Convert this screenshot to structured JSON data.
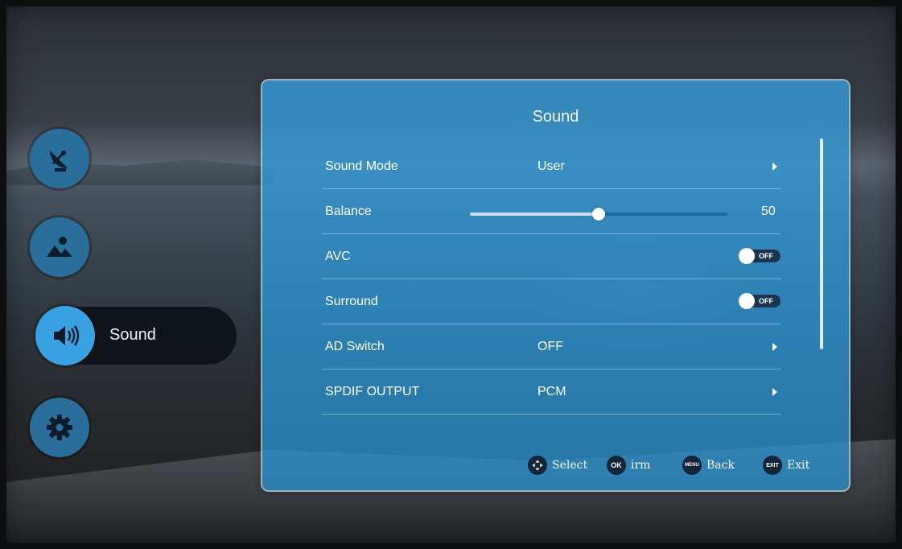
{
  "side_menu": {
    "items": [
      {
        "icon": "satellite-dish-icon",
        "label": ""
      },
      {
        "icon": "picture-icon",
        "label": ""
      },
      {
        "icon": "speaker-icon",
        "label": "Sound"
      },
      {
        "icon": "gear-icon",
        "label": ""
      }
    ],
    "selected": "Sound"
  },
  "panel": {
    "title": "Sound",
    "rows": [
      {
        "label": "Sound Mode",
        "value": "User",
        "type": "submenu"
      },
      {
        "label": "Balance",
        "value": "50",
        "type": "slider",
        "fraction": 0.5
      },
      {
        "label": "AVC",
        "value": "OFF",
        "type": "toggle"
      },
      {
        "label": "Surround",
        "value": "OFF",
        "type": "toggle"
      },
      {
        "label": "AD Switch",
        "value": "OFF",
        "type": "submenu"
      },
      {
        "label": "SPDIF OUTPUT",
        "value": "PCM",
        "type": "submenu"
      }
    ]
  },
  "footer": {
    "hints": [
      {
        "badge": "",
        "text": "Select",
        "icon": "dpad-icon"
      },
      {
        "badge": "OK",
        "text": "irm"
      },
      {
        "badge": "MENU",
        "text": "Back"
      },
      {
        "badge": "EXIT",
        "text": "Exit"
      }
    ]
  },
  "colors": {
    "panel": "#3aa1e2",
    "selected_icon": "#3aa1e2",
    "icon_bg": "#2a6e9b",
    "badge": "#14243a"
  }
}
